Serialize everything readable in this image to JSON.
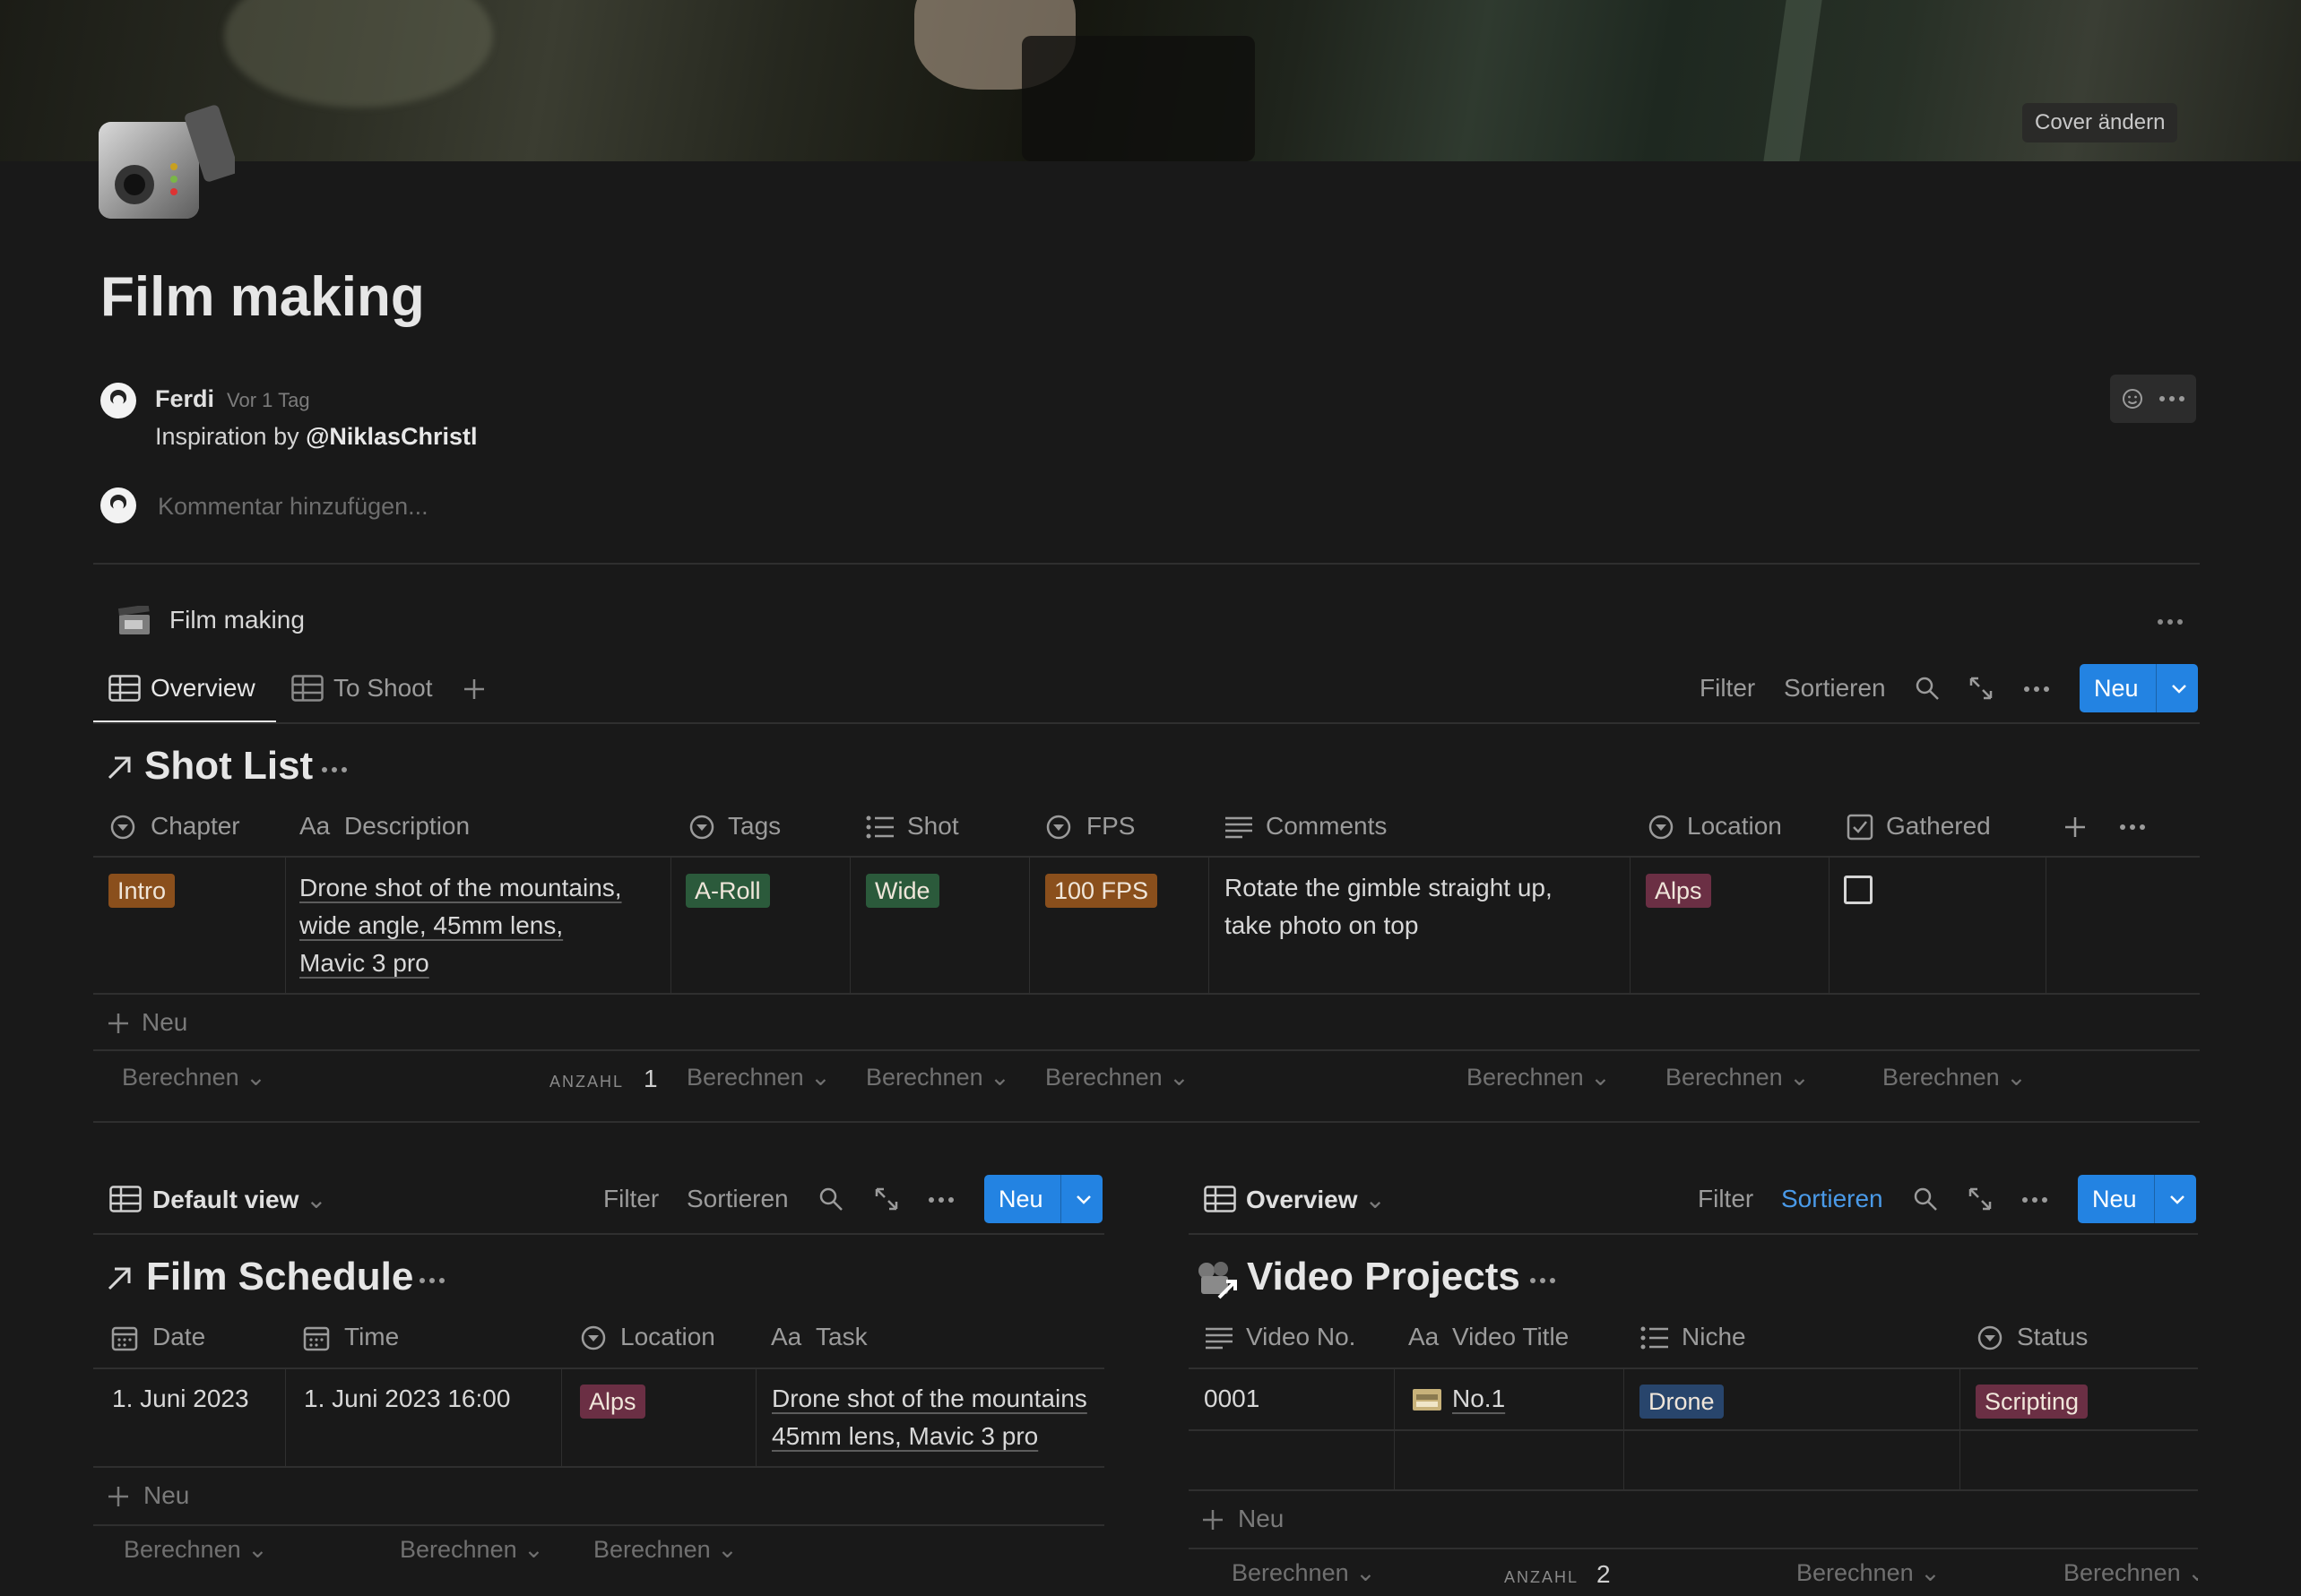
{
  "cover": {
    "button_label": "Cover ändern"
  },
  "page": {
    "title": "Film making",
    "icon": "video-camera-icon"
  },
  "comment": {
    "author": "Ferdi",
    "time": "Vor 1 Tag",
    "text_prefix": "Inspiration by ",
    "text_mention": "@NiklasChristl",
    "placeholder": "Kommentar hinzufügen..."
  },
  "database": {
    "name": "Film making",
    "tabs": [
      {
        "label": "Overview",
        "active": true
      },
      {
        "label": "To Shoot",
        "active": false
      }
    ],
    "toolbar": {
      "filter": "Filter",
      "sort": "Sortieren",
      "new": "Neu"
    }
  },
  "shot_list": {
    "title": "Shot List",
    "columns": [
      "Chapter",
      "Description",
      "Tags",
      "Shot",
      "FPS",
      "Comments",
      "Location",
      "Gathered"
    ],
    "rows": [
      {
        "chapter": "Intro",
        "description": [
          "Drone shot of the mountains,",
          "wide angle, 45mm lens,",
          "Mavic 3 pro"
        ],
        "tags": "A-Roll",
        "shot": "Wide",
        "fps": "100 FPS",
        "comments": [
          "Rotate the gimble straight up,",
          "take photo on top"
        ],
        "location": "Alps",
        "gathered": false
      }
    ],
    "new_row": "Neu",
    "calc": "Berechnen",
    "count_label": "ANZAHL",
    "count": "1"
  },
  "film_schedule": {
    "view": "Default view",
    "toolbar": {
      "filter": "Filter",
      "sort": "Sortieren",
      "new": "Neu"
    },
    "title": "Film Schedule",
    "columns": [
      "Date",
      "Time",
      "Location",
      "Task"
    ],
    "rows": [
      {
        "date": "1. Juni 2023",
        "time": "1. Juni 2023 16:00",
        "location": "Alps",
        "task": [
          "Drone shot of the mountains",
          "45mm lens, Mavic 3 pro"
        ]
      }
    ],
    "new_row": "Neu",
    "calc": "Berechnen"
  },
  "video_projects": {
    "view": "Overview",
    "toolbar": {
      "filter": "Filter",
      "sort": "Sortieren",
      "new": "Neu"
    },
    "title": "Video Projects",
    "columns": [
      "Video No.",
      "Video Title",
      "Niche",
      "Status"
    ],
    "rows": [
      {
        "no": "0001",
        "title": "No.1",
        "niche": "Drone",
        "status": "Scripting"
      }
    ],
    "new_row": "Neu",
    "calc": "Berechnen",
    "count_label": "ANZAHL",
    "count": "2"
  },
  "colors": {
    "accent": "#2383e2",
    "tag_orange": "#8a4f1c",
    "tag_green": "#2b5a3b",
    "tag_red": "#6b2f44",
    "tag_blue": "#28456c"
  }
}
